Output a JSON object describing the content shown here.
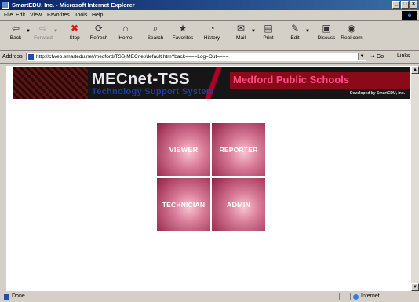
{
  "window": {
    "title": "SmartEDU, Inc. - Microsoft Internet Explorer",
    "controls": {
      "minimize": "_",
      "maximize": "□",
      "close": "×"
    }
  },
  "menu": [
    "File",
    "Edit",
    "View",
    "Favorites",
    "Tools",
    "Help"
  ],
  "toolbar": [
    {
      "label": "Back",
      "icon": "back-arrow-icon",
      "glyph": "⇦"
    },
    {
      "label": "Forward",
      "icon": "forward-arrow-icon",
      "glyph": "⇨",
      "disabled": true
    },
    {
      "label": "Stop",
      "icon": "stop-icon",
      "glyph": "✖"
    },
    {
      "label": "Refresh",
      "icon": "refresh-icon",
      "glyph": "⟳"
    },
    {
      "label": "Home",
      "icon": "home-icon",
      "glyph": "⌂"
    },
    {
      "label": "Search",
      "icon": "search-icon",
      "glyph": "⌕"
    },
    {
      "label": "Favorites",
      "icon": "favorites-icon",
      "glyph": "★"
    },
    {
      "label": "History",
      "icon": "history-icon",
      "glyph": "◔"
    },
    {
      "label": "Mail",
      "icon": "mail-icon",
      "glyph": "✉"
    },
    {
      "label": "Print",
      "icon": "print-icon",
      "glyph": "▤"
    },
    {
      "label": "Edit",
      "icon": "edit-icon",
      "glyph": "✎"
    },
    {
      "label": "Discuss",
      "icon": "discuss-icon",
      "glyph": "▣"
    },
    {
      "label": "Real.com",
      "icon": "real-icon",
      "glyph": "◉"
    }
  ],
  "address": {
    "label": "Address",
    "url": "http://cfweb.smartedu.net/medford/TSS-MECnet/default.htm?back====Log=Out====",
    "go": "Go",
    "links": "Links"
  },
  "banner": {
    "title": "MECnet-TSS",
    "subtitle": "Technology Support System",
    "school": "Medford Public Schools",
    "developer": "Developed by SmartEDU, Inc."
  },
  "tiles": {
    "viewer": "VIEWER",
    "reporter": "REPORTER",
    "technician": "TECHNICIAN",
    "admin": "ADMIN"
  },
  "status": {
    "text": "Done",
    "zone": "Internet"
  }
}
